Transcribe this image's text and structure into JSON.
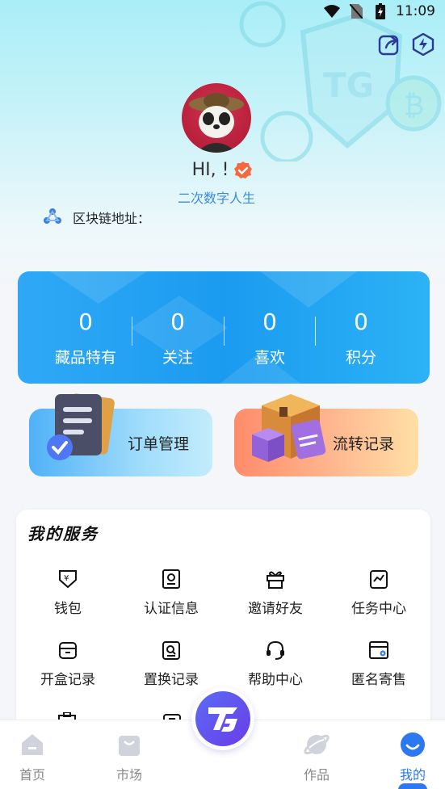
{
  "status_bar": {
    "time": "11:09"
  },
  "profile": {
    "greeting": "HI, !",
    "subtitle": "二次数字人生",
    "chain_label": "区块链地址："
  },
  "stats": [
    {
      "value": "0",
      "label": "藏品特有"
    },
    {
      "value": "0",
      "label": "关注"
    },
    {
      "value": "0",
      "label": "喜欢"
    },
    {
      "value": "0",
      "label": "积分"
    }
  ],
  "cards": {
    "orders": "订单管理",
    "transfer": "流转记录"
  },
  "services": {
    "title": "我的服务",
    "items": [
      {
        "label": "钱包",
        "icon": "wallet-icon"
      },
      {
        "label": "认证信息",
        "icon": "certificate-icon"
      },
      {
        "label": "邀请好友",
        "icon": "gift-icon"
      },
      {
        "label": "任务中心",
        "icon": "clipboard-chart-icon"
      },
      {
        "label": "开盒记录",
        "icon": "box-icon"
      },
      {
        "label": "置换记录",
        "icon": "exchange-doc-icon"
      },
      {
        "label": "帮助中心",
        "icon": "headset-icon"
      },
      {
        "label": "匿名寄售",
        "icon": "browser-gear-icon"
      }
    ]
  },
  "tabbar": [
    {
      "label": "首页",
      "icon": "home-icon",
      "active": false
    },
    {
      "label": "市场",
      "icon": "bag-icon",
      "active": false
    },
    {
      "label": "作品",
      "icon": "planet-icon",
      "active": false
    },
    {
      "label": "我的",
      "icon": "smile-icon",
      "active": true
    }
  ],
  "colors": {
    "accent": "#2b78f0",
    "stats_bg": "#1b9bf0",
    "subtitle": "#3b8bd8"
  }
}
